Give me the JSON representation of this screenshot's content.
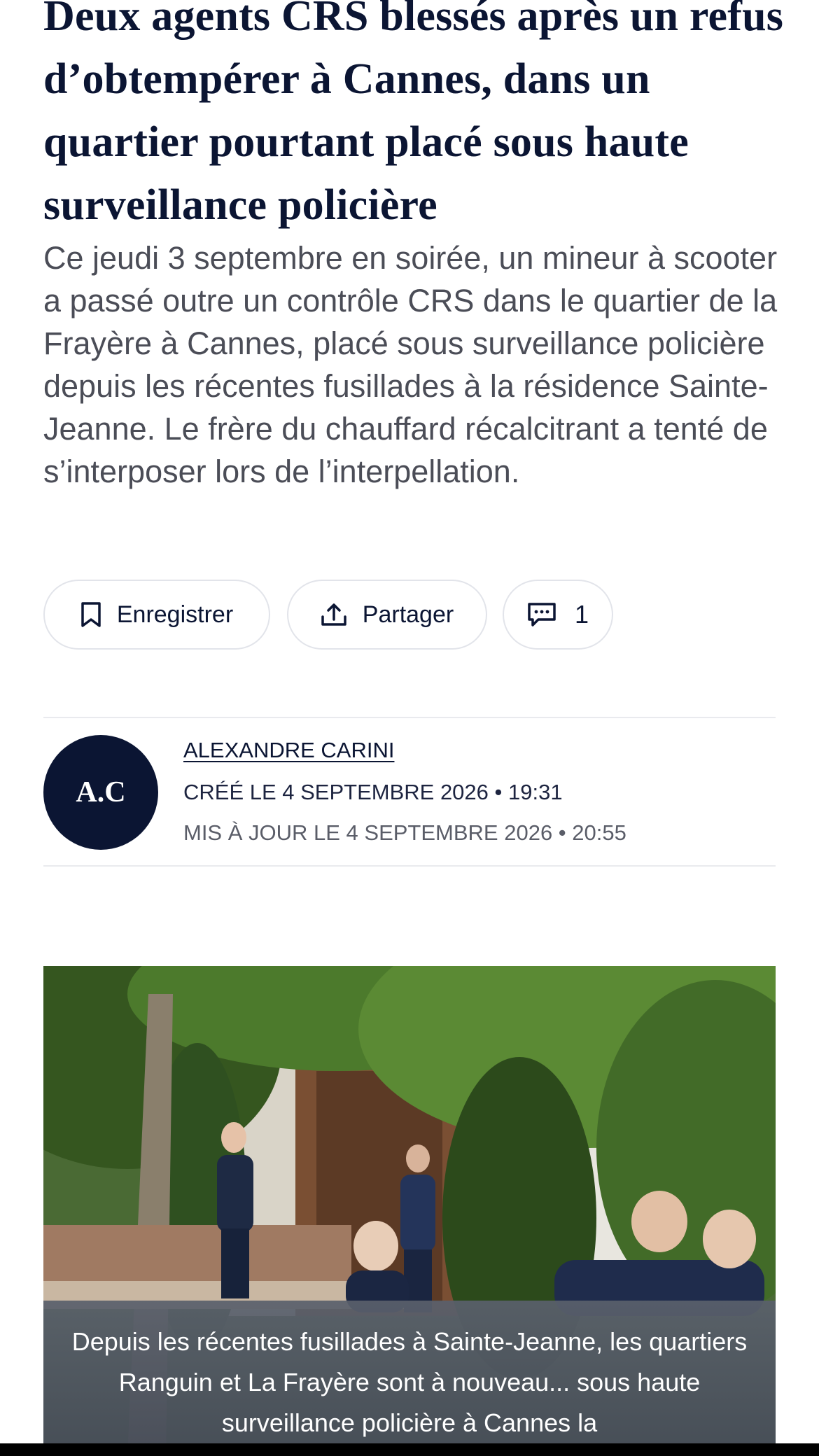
{
  "article": {
    "headline": "Deux agents CRS blessés après un refus d’obtempérer à Cannes, dans un quartier pourtant placé sous haute surveillance policière",
    "lead": "Ce jeudi 3 septembre en soirée, un mineur à scooter a passé outre un contrôle CRS dans le quartier de la Frayère à Cannes, placé sous surveillance policière depuis les récentes fusillades à la résidence Sainte-Jeanne. Le frère du chauffard récalcitrant a tenté de s’interposer lors de l’interpellation."
  },
  "actions": {
    "save_label": "Enregistrer",
    "share_label": "Partager",
    "comments_count": "1"
  },
  "author": {
    "initials": "A.C",
    "name": "ALEXANDRE CARINI",
    "created": "CRÉÉ LE 4 SEPTEMBRE 2026 • 19:31",
    "updated": "MIS À JOUR LE 4 SEPTEMBRE 2026 • 20:55"
  },
  "photo": {
    "caption": "Depuis les récentes fusillades à Sainte-Jeanne, les quartiers Ranguin et La Frayère sont à nouveau... sous haute surveillance policière à Cannes la"
  },
  "colors": {
    "navy": "#0b1533",
    "muted_text": "#4b4d57",
    "border": "#e2e4ea"
  }
}
